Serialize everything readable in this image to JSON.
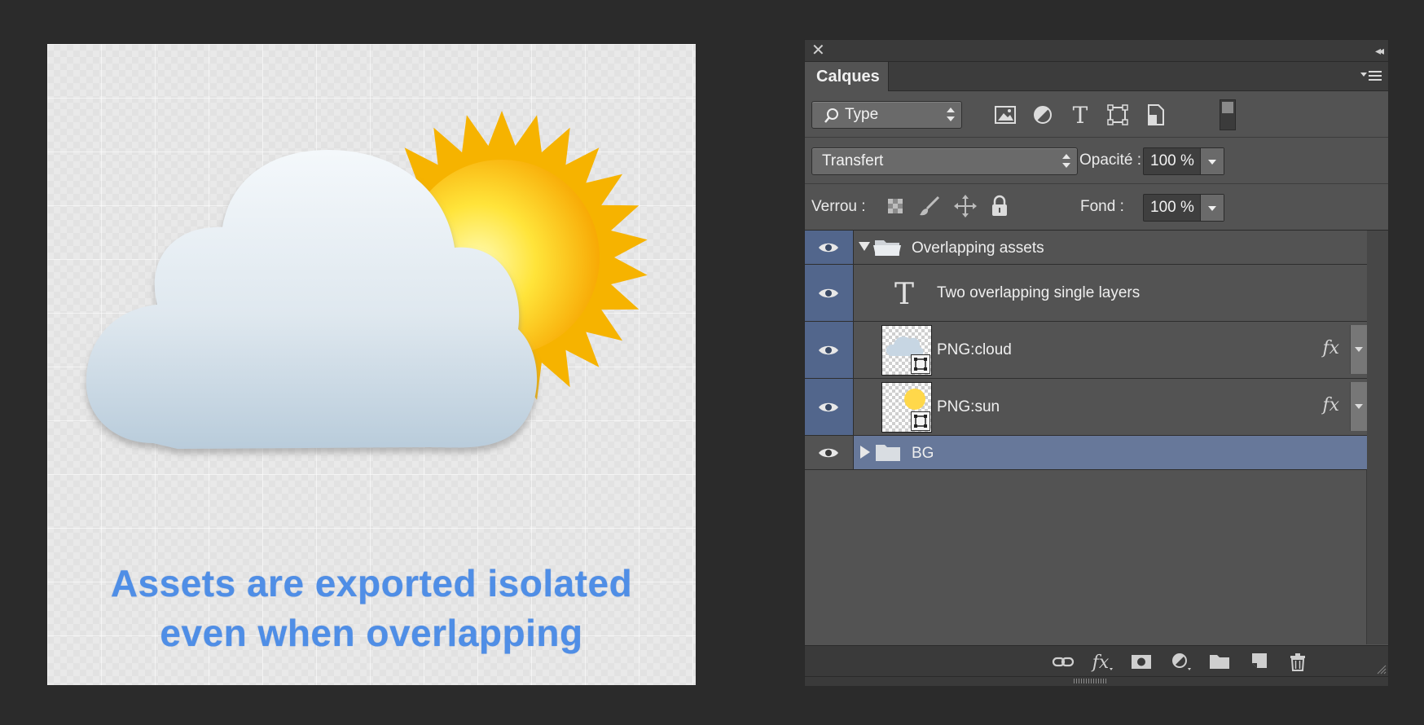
{
  "canvas": {
    "caption_line1": "Assets are exported isolated",
    "caption_line2": "even when overlapping",
    "caption_color": "#4f8ee6"
  },
  "panel": {
    "close_glyph": "✕",
    "collapse_glyph": "◂◂",
    "tab_label": "Calques",
    "filter": {
      "kind": "Type",
      "icons": [
        "image-filter-icon",
        "adjustment-filter-icon",
        "type-filter-icon",
        "shape-filter-icon",
        "smart-object-filter-icon"
      ]
    },
    "blend_mode": "Transfert",
    "opacity_label": "Opacité :",
    "opacity_value": "100 %",
    "lock_label": "Verrou :",
    "fill_label": "Fond :",
    "fill_value": "100 %",
    "layers": [
      {
        "name": "Overlapping assets",
        "type": "group",
        "expanded": true
      },
      {
        "name": "Two overlapping single layers",
        "type": "text"
      },
      {
        "name": "PNG:cloud",
        "type": "smart-object",
        "fx": "fx"
      },
      {
        "name": "PNG:sun",
        "type": "smart-object",
        "fx": "fx"
      },
      {
        "name": "BG",
        "type": "group",
        "expanded": false,
        "selected": true
      }
    ],
    "bottom_icons": [
      "link-layers-icon",
      "fx-icon",
      "mask-icon",
      "adjustment-icon",
      "new-group-icon",
      "new-layer-icon",
      "trash-icon"
    ],
    "accent_color": "#52668c"
  }
}
